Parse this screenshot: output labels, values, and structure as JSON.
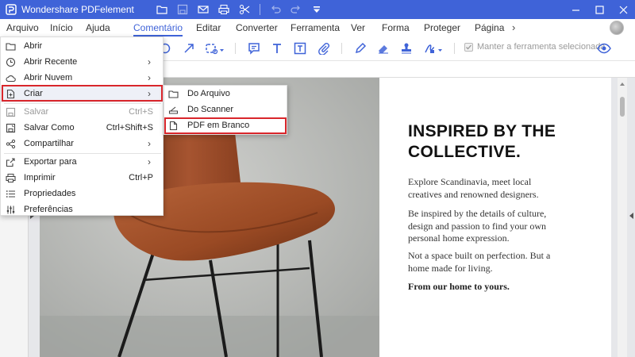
{
  "app": {
    "title": "Wondershare PDFelement"
  },
  "titlebar_icons": [
    "folder-icon",
    "save-icon",
    "mail-icon",
    "print-icon",
    "scissors-icon",
    "undo-icon",
    "redo-icon",
    "quick-access-dropdown-icon"
  ],
  "menubar": {
    "items": [
      {
        "id": "arquivo",
        "label": "Arquivo"
      },
      {
        "id": "inicio",
        "label": "Início"
      },
      {
        "id": "ajuda",
        "label": "Ajuda"
      },
      {
        "id": "comentario",
        "label": "Comentário",
        "active": true
      },
      {
        "id": "editar",
        "label": "Editar"
      },
      {
        "id": "converter",
        "label": "Converter"
      },
      {
        "id": "ferramenta",
        "label": "Ferramenta"
      },
      {
        "id": "ver",
        "label": "Ver"
      },
      {
        "id": "forma",
        "label": "Forma"
      },
      {
        "id": "proteger",
        "label": "Proteger"
      },
      {
        "id": "pagina",
        "label": "Página"
      }
    ],
    "more": "›"
  },
  "toolbar": {
    "keep_tool_label": "Manter a ferramenta selecionada",
    "keep_tool_checked": true
  },
  "file_menu": {
    "items": [
      {
        "label": "Abrir",
        "icon": "folder-icon"
      },
      {
        "label": "Abrir Recente",
        "icon": "clock-icon",
        "submenu": true
      },
      {
        "label": "Abrir Nuvem",
        "icon": "cloud-icon",
        "submenu": true
      },
      {
        "label": "Criar",
        "icon": "new-document-icon",
        "submenu": true,
        "highlighted": true
      },
      {
        "label": "Salvar",
        "icon": "save-icon",
        "shortcut": "Ctrl+S",
        "disabled": true
      },
      {
        "label": "Salvar Como",
        "icon": "save-as-icon",
        "shortcut": "Ctrl+Shift+S"
      },
      {
        "label": "Compartilhar",
        "icon": "share-icon",
        "submenu": true
      },
      {
        "label": "Exportar para",
        "icon": "export-icon",
        "submenu": true
      },
      {
        "label": "Imprimir",
        "icon": "print-icon",
        "shortcut": "Ctrl+P"
      },
      {
        "label": "Propriedades",
        "icon": "list-icon"
      },
      {
        "label": "Preferências",
        "icon": "sliders-icon"
      }
    ],
    "arrow": "›"
  },
  "create_submenu": {
    "items": [
      {
        "label": "Do Arquivo",
        "icon": "folder-icon"
      },
      {
        "label": "Do Scanner",
        "icon": "scanner-icon"
      },
      {
        "label": "PDF em Branco",
        "icon": "blank-page-icon",
        "highlighted": true
      }
    ]
  },
  "document": {
    "headline": "INSPIRED BY THE COLLECTIVE.",
    "paragraphs": [
      "Explore Scandinavia, meet local creatives and renowned designers.",
      "Be inspired by the details of culture, design and passion to find your own personal home expression.",
      "Not a space built on perfection. But a home made for living."
    ],
    "closing": "From our home to yours."
  },
  "colors": {
    "accent": "#3f63d8",
    "highlight_box": "#d9262b",
    "chair_leather": "#9a4a24"
  }
}
